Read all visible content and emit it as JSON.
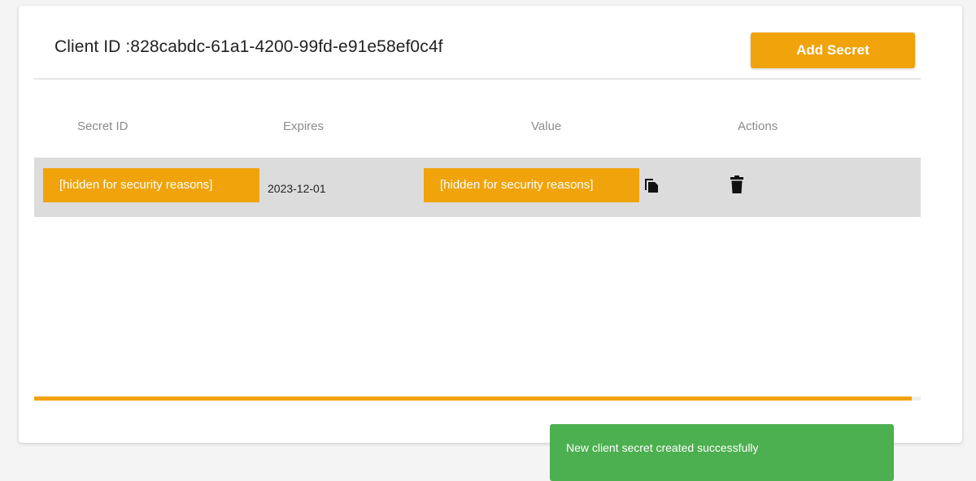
{
  "header": {
    "client_id_text": "Client ID :828cabdc-61a1-4200-99fd-e91e58ef0c4f",
    "add_secret_label": "Add Secret"
  },
  "table": {
    "columns": [
      "Secret ID",
      "Expires",
      "Value",
      "Actions"
    ],
    "rows": [
      {
        "secret_id": "[hidden for security reasons]",
        "expires": "2023-12-01",
        "value": "[hidden for security reasons]",
        "actions": [
          "copy-icon",
          "trash-icon"
        ]
      }
    ]
  },
  "progress": {
    "fraction": 0.99
  },
  "toast": {
    "message": "New client secret created successfully"
  },
  "colors": {
    "accent": "#f0a30a",
    "toast_success": "#4caf50",
    "row_background": "#dcdcdc"
  }
}
